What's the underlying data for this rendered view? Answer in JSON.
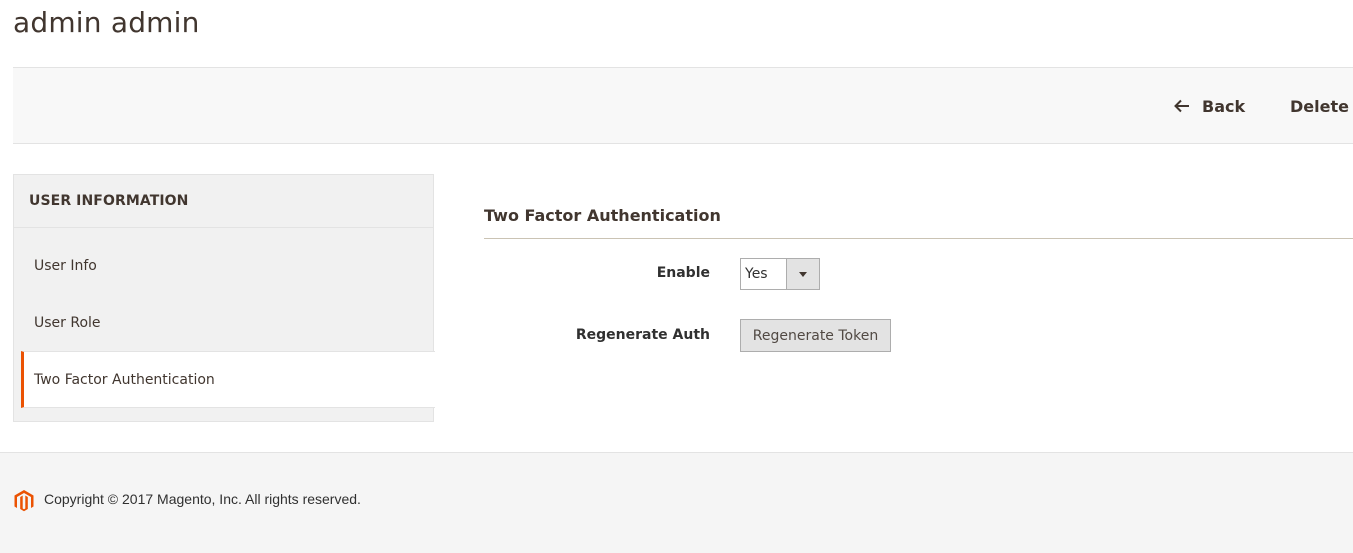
{
  "page": {
    "title": "admin admin"
  },
  "actions": {
    "back_label": "Back",
    "delete_label": "Delete User"
  },
  "tabs": {
    "header": "USER INFORMATION",
    "items": [
      {
        "label": "User Info"
      },
      {
        "label": "User Role"
      },
      {
        "label": "Two Factor Authentication"
      }
    ]
  },
  "section": {
    "title": "Two Factor Authentication",
    "enable": {
      "label": "Enable",
      "value": "Yes"
    },
    "regenerate": {
      "label": "Regenerate Auth",
      "button_label": "Regenerate Token"
    }
  },
  "footer": {
    "copyright": "Copyright © 2017 Magento, Inc. All rights reserved."
  },
  "icons": {
    "back": "arrow-left-icon",
    "select": "chevron-down-icon",
    "logo": "magento-logo-icon"
  },
  "colors": {
    "accent": "#eb5202",
    "text": "#41362f"
  }
}
